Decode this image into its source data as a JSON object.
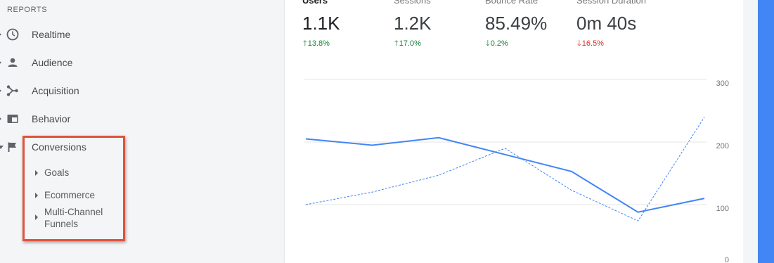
{
  "sidebar": {
    "section_header": "REPORTS",
    "items": [
      {
        "label": "Realtime",
        "icon": "clock-icon"
      },
      {
        "label": "Audience",
        "icon": "person-icon"
      },
      {
        "label": "Acquisition",
        "icon": "acquisition-icon"
      },
      {
        "label": "Behavior",
        "icon": "behavior-icon"
      },
      {
        "label": "Conversions",
        "icon": "flag-icon"
      }
    ],
    "conversions_subitems": [
      {
        "label": "Goals"
      },
      {
        "label": "Ecommerce"
      },
      {
        "label": "Multi-Channel Funnels"
      }
    ]
  },
  "metrics": [
    {
      "label": "Users",
      "value": "1.1K",
      "delta": "13.8%",
      "direction": "up",
      "color": "#188038"
    },
    {
      "label": "Sessions",
      "value": "1.2K",
      "delta": "17.0%",
      "direction": "up",
      "color": "#188038"
    },
    {
      "label": "Bounce Rate",
      "value": "85.49%",
      "delta": "0.2%",
      "direction": "down",
      "color": "#188038"
    },
    {
      "label": "Session Duration",
      "value": "0m 40s",
      "delta": "16.5%",
      "direction": "down",
      "color": "#d93025"
    }
  ],
  "chart_data": {
    "type": "line",
    "ylim": [
      0,
      300
    ],
    "yticks": [
      "300",
      "200",
      "100",
      "0"
    ],
    "grid": true,
    "series": [
      {
        "style": "solid",
        "color": "#4285f4",
        "values": [
          205,
          195,
          207,
          180,
          153,
          88,
          110
        ]
      },
      {
        "style": "dashed",
        "color": "#4285f4",
        "values": [
          100,
          120,
          147,
          190,
          123,
          74,
          240
        ]
      }
    ]
  },
  "colors": {
    "accent": "#4285f4",
    "highlight_box": "#e0533d"
  }
}
